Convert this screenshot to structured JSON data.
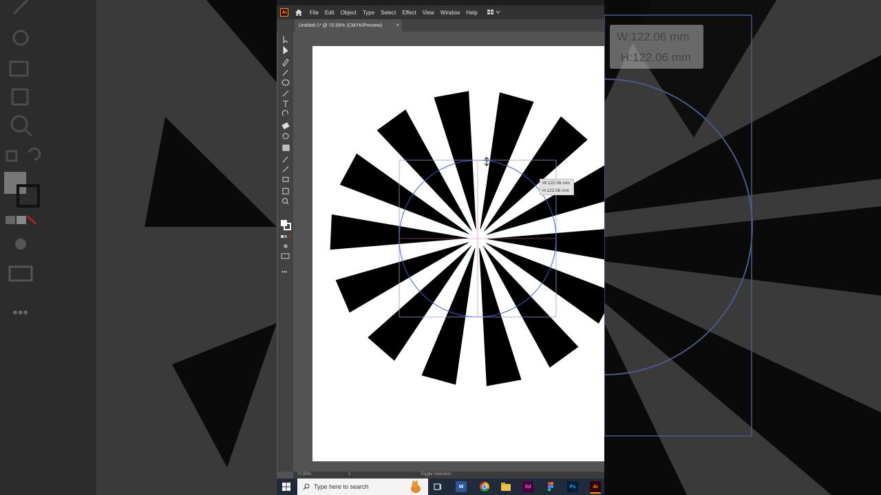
{
  "app": {
    "logo": "Ai",
    "menu": [
      "File",
      "Edit",
      "Object",
      "Type",
      "Select",
      "Effect",
      "View",
      "Window",
      "Help"
    ],
    "document_tab": "Untitled-1* @ 70.59% (CMYK/Preview)",
    "tab_close": "×"
  },
  "measure": {
    "width": "W:122.06 mm",
    "height": "H:122.06 mm"
  },
  "status": {
    "zoom": "70.59%",
    "page": "1",
    "tool": "Toggle Selection"
  },
  "taskbar": {
    "search_placeholder": "Type here to search",
    "apps": [
      "task-view",
      "word",
      "chrome",
      "file-explorer",
      "xd",
      "figma",
      "photoshop",
      "illustrator"
    ],
    "labels": {
      "word": "W",
      "xd": "Xd",
      "photoshop": "Ps",
      "illustrator": "Ai"
    }
  },
  "colors": {
    "accent": "#ff9a00",
    "selection": "#3a5fcd",
    "shape": "#000000"
  },
  "chart_data": {
    "type": "sunburst-rays",
    "ray_count": 14
  }
}
